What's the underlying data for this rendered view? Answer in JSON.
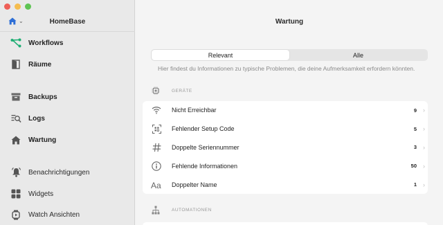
{
  "window": {
    "app_title": "HomeBase"
  },
  "sidebar": {
    "items": [
      {
        "label": "Workflows",
        "icon": "workflows-icon",
        "bold": true
      },
      {
        "label": "Räume",
        "icon": "door-icon",
        "bold": true
      },
      {
        "label": "Backups",
        "icon": "archive-box-icon",
        "bold": true
      },
      {
        "label": "Logs",
        "icon": "logs-search-icon",
        "bold": true
      },
      {
        "label": "Wartung",
        "icon": "house-icon",
        "bold": true
      },
      {
        "label": "Benachrichtigungen",
        "icon": "bell-icon",
        "bold": false
      },
      {
        "label": "Widgets",
        "icon": "widgets-grid-icon",
        "bold": false
      },
      {
        "label": "Watch Ansichten",
        "icon": "watch-icon",
        "bold": false
      }
    ]
  },
  "main": {
    "title": "Wartung",
    "segments": [
      {
        "label": "Relevant",
        "active": true
      },
      {
        "label": "Alle",
        "active": false
      }
    ],
    "info": "Hier findest du Informationen zu typische Problemen, die deine Aufmerksamkeit erfordern könnten.",
    "sections": [
      {
        "header": "GERÄTE",
        "rows": [
          {
            "label": "Nicht Erreichbar",
            "count": "9",
            "icon": "wifi-off-icon"
          },
          {
            "label": "Fehlender Setup Code",
            "count": "5",
            "icon": "qr-scan-icon"
          },
          {
            "label": "Doppelte Seriennummer",
            "count": "3",
            "icon": "hash-icon"
          },
          {
            "label": "Fehlende Informationen",
            "count": "50",
            "icon": "info-circle-icon"
          },
          {
            "label": "Doppelter Name",
            "count": "1",
            "icon": "text-aa-icon"
          }
        ]
      },
      {
        "header": "AUTOMATIONEN"
      }
    ]
  },
  "colors": {
    "accent_green": "#1fae74",
    "accent_blue": "#2f6fd6",
    "sidebar_icon": "#555555"
  }
}
